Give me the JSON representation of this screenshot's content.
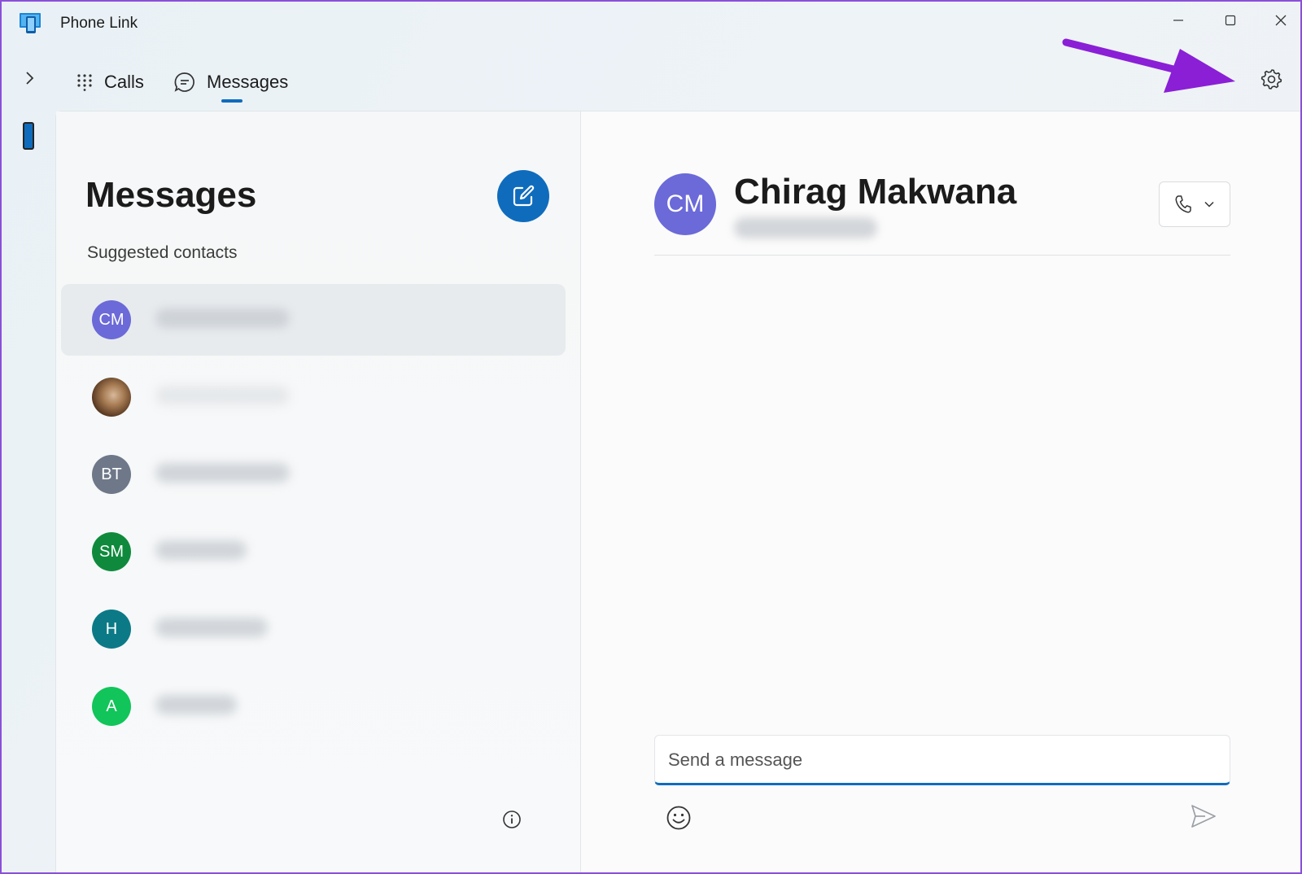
{
  "window": {
    "title": "Phone Link"
  },
  "nav": {
    "tabs": [
      {
        "label": "Calls",
        "icon": "dialpad-icon"
      },
      {
        "label": "Messages",
        "icon": "chat-icon",
        "active": true
      }
    ]
  },
  "messages_list": {
    "title": "Messages",
    "section_label": "Suggested contacts",
    "contacts": [
      {
        "initials": "CM",
        "color": "#6b6ad8",
        "selected": true
      },
      {
        "initials": "",
        "photo": true
      },
      {
        "initials": "BT",
        "color": "#6e7889"
      },
      {
        "initials": "SM",
        "color": "#0f8a3c"
      },
      {
        "initials": "H",
        "color": "#0b7a86"
      },
      {
        "initials": "A",
        "color": "#11c55a"
      }
    ]
  },
  "conversation": {
    "initials": "CM",
    "name": "Chirag Makwana",
    "composer_placeholder": "Send a message"
  },
  "colors": {
    "accent": "#0f6cbd",
    "annotation_arrow": "#8a1fd6"
  }
}
